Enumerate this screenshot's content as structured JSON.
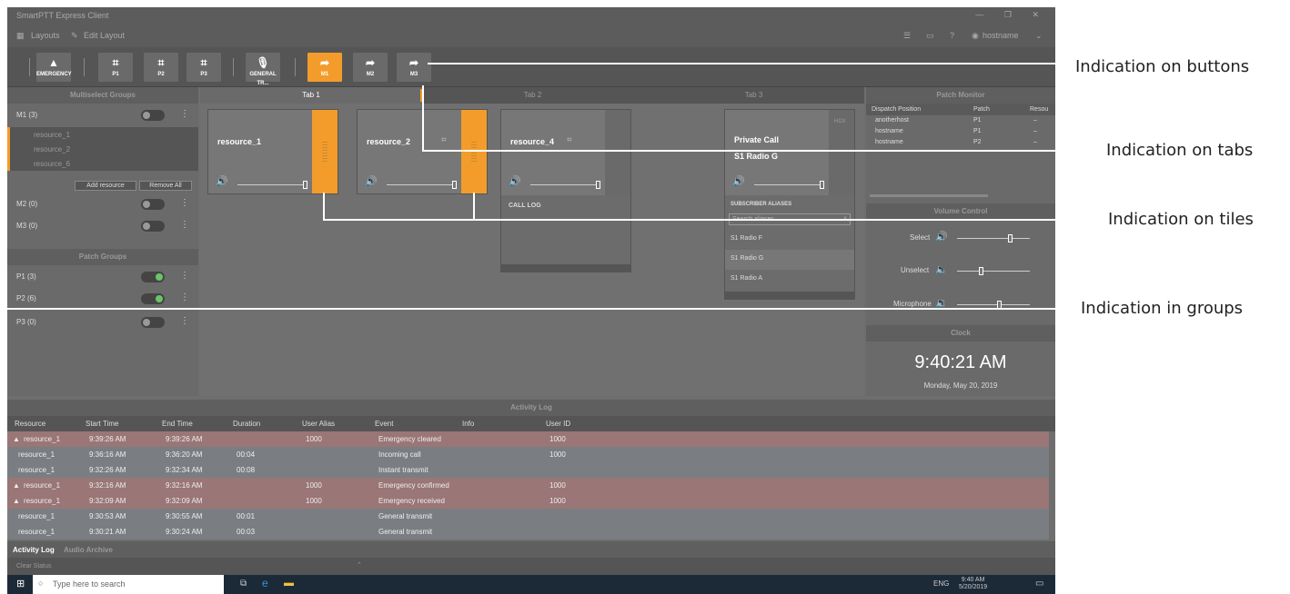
{
  "window": {
    "title": "SmartPTT Express Client",
    "controls": "— ❐ ✕"
  },
  "menu": {
    "layouts": "Layouts",
    "edit_layout": "Edit Layout",
    "user": "hostname"
  },
  "toolbar": {
    "buttons": [
      {
        "label": "EMERGENCY",
        "icon": "▲",
        "active": false
      },
      {
        "label": "P1",
        "icon": "⌗",
        "active": false
      },
      {
        "label": "P2",
        "icon": "⌗",
        "active": false
      },
      {
        "label": "P3",
        "icon": "⌗",
        "active": false
      },
      {
        "label": "GENERAL TR...",
        "icon": "🎙",
        "active": false
      },
      {
        "label": "M1",
        "icon": "➦",
        "active": true
      },
      {
        "label": "M2",
        "icon": "➦",
        "active": false
      },
      {
        "label": "M3",
        "icon": "➦",
        "active": false
      }
    ]
  },
  "multiselect": {
    "title": "Multiselect Groups",
    "groups": [
      {
        "name": "M1 (3)",
        "resources": [
          "resource_1",
          "resource_2",
          "resource_6"
        ]
      },
      {
        "name": "M2 (0)"
      },
      {
        "name": "M3 (0)"
      }
    ],
    "add_resource": "Add resource",
    "remove_all": "Remove All"
  },
  "patch": {
    "title": "Patch Groups",
    "groups": [
      {
        "name": "P1 (3)",
        "on": true
      },
      {
        "name": "P2 (6)",
        "on": true
      },
      {
        "name": "P3 (0)",
        "on": false
      }
    ]
  },
  "tabs": [
    "Tab 1",
    "Tab 2",
    "Tab 3"
  ],
  "tiles": {
    "r1": "resource_1",
    "r2": "resource_2",
    "r4": "resource_4",
    "call_log": "CALL LOG",
    "pc_title": "Private Call",
    "pc_sub": "S1 Radio G",
    "hdx": "HDX",
    "aliases_title": "SUBSCRIBER ALIASES",
    "search_ph": "Search aliases...",
    "aliases": [
      "S1 Radio F",
      "S1 Radio G",
      "S1 Radio A"
    ]
  },
  "patch_monitor": {
    "title": "Patch Monitor",
    "cols": [
      "Dispatch Position",
      "Patch",
      "Resou"
    ],
    "rows": [
      [
        "anotherhost",
        "P1",
        "–"
      ],
      [
        "hostname",
        "P1",
        "–"
      ],
      [
        "hostname",
        "P2",
        "–"
      ]
    ]
  },
  "volume": {
    "title": "Volume Control",
    "select": "Select",
    "unselect": "Unselect",
    "mic": "Microphone",
    "levels": {
      "select": 0.7,
      "unselect": 0.3,
      "mic": 0.55
    }
  },
  "clock": {
    "title": "Clock",
    "time": "9:40:21 AM",
    "date": "Monday, May 20, 2019"
  },
  "log": {
    "title": "Activity Log",
    "cols": [
      "Resource",
      "Start Time",
      "End Time",
      "Duration",
      "User Alias",
      "Event",
      "Info",
      "User ID"
    ],
    "rows": [
      {
        "em": true,
        "c": [
          "resource_1",
          "9:39:26 AM",
          "9:39:26 AM",
          "",
          "1000",
          "Emergency cleared",
          "",
          "1000"
        ]
      },
      {
        "em": false,
        "c": [
          "resource_1",
          "9:36:16 AM",
          "9:36:20 AM",
          "00:04",
          "",
          "Incoming call",
          "",
          "1000"
        ]
      },
      {
        "em": false,
        "c": [
          "resource_1",
          "9:32:26 AM",
          "9:32:34 AM",
          "00:08",
          "",
          "Instant transmit",
          "",
          ""
        ]
      },
      {
        "em": true,
        "c": [
          "resource_1",
          "9:32:16 AM",
          "9:32:16 AM",
          "",
          "1000",
          "Emergency confirmed",
          "",
          "1000"
        ]
      },
      {
        "em": true,
        "c": [
          "resource_1",
          "9:32:09 AM",
          "9:32:09 AM",
          "",
          "1000",
          "Emergency received",
          "",
          "1000"
        ]
      },
      {
        "em": false,
        "c": [
          "resource_1",
          "9:30:53 AM",
          "9:30:55 AM",
          "00:01",
          "",
          "General transmit",
          "",
          ""
        ]
      },
      {
        "em": false,
        "c": [
          "resource_1",
          "9:30:21 AM",
          "9:30:24 AM",
          "00:03",
          "",
          "General transmit",
          "",
          ""
        ]
      }
    ],
    "tabs": [
      "Activity Log",
      "Audio Archive"
    ],
    "clear": "Clear Status"
  },
  "taskbar": {
    "search_ph": "Type here to search",
    "lang": "ENG",
    "time": "9:40 AM",
    "date": "5/20/2019"
  },
  "annotations": [
    "Indication on buttons",
    "Indication on tabs",
    "Indication on tiles",
    "Indication in groups"
  ]
}
